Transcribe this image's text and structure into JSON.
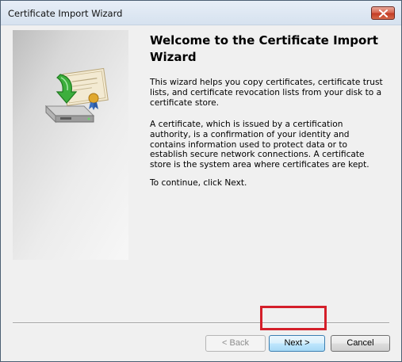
{
  "window": {
    "title": "Certificate Import Wizard"
  },
  "content": {
    "heading": "Welcome to the Certificate Import Wizard",
    "paragraphs": [
      "This wizard helps you copy certificates, certificate trust lists, and certificate revocation lists from your disk to a certificate store.",
      "A certificate, which is issued by a certification authority, is a confirmation of your identity and contains information used to protect data or to establish secure network connections. A certificate store is the system area where certificates are kept.",
      "To continue, click Next."
    ]
  },
  "buttons": {
    "back": "< Back",
    "next": "Next >",
    "cancel": "Cancel"
  },
  "icons": {
    "close": "close-icon",
    "wizard": "certificate-import-icon"
  },
  "colors": {
    "highlight": "#d41f2a",
    "close_button": "#c23a24"
  }
}
